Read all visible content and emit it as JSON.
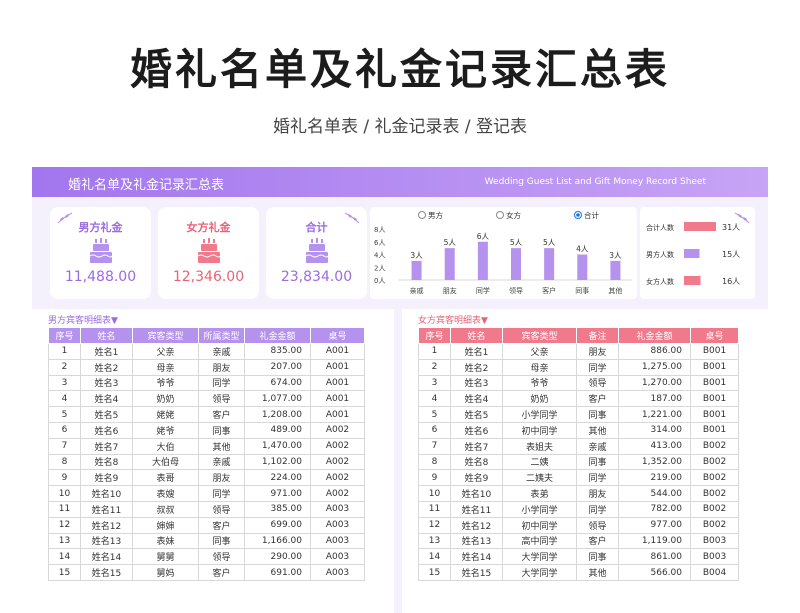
{
  "header": {
    "title": "婚礼名单及礼金记录汇总表",
    "subtitle": "婚礼名单表 / 礼金记录表 / 登记表"
  },
  "banner": {
    "title_cn": "婚礼名单及礼金记录汇总表",
    "title_en": "Wedding Guest List and Gift Money Record Sheet"
  },
  "colors": {
    "purple": "#b492ee",
    "pink": "#f07a8c",
    "purple_text": "#9b6be0",
    "pink_text": "#e8637a"
  },
  "cards": [
    {
      "label": "男方礼金",
      "value": "11,488.00",
      "icon": "cake-icon"
    },
    {
      "label": "女方礼金",
      "value": "12,346.00",
      "icon": "cake-icon"
    },
    {
      "label": "合计",
      "value": "23,834.00",
      "icon": "cake-icon"
    }
  ],
  "chart_data": {
    "type": "bar",
    "radio_options": [
      "男方",
      "女方",
      "合计"
    ],
    "selected": "合计",
    "categories": [
      "亲戚",
      "朋友",
      "同学",
      "领导",
      "客户",
      "同事",
      "其他"
    ],
    "values": [
      3,
      5,
      6,
      5,
      5,
      4,
      3
    ],
    "data_labels": [
      "3人",
      "5人",
      "6人",
      "5人",
      "5人",
      "4人",
      "3人"
    ],
    "yticks": [
      "0人",
      "2人",
      "4人",
      "6人",
      "8人"
    ],
    "ylim": [
      0,
      8
    ]
  },
  "legend_summary": [
    {
      "label": "合计人数",
      "value": "31人",
      "count": 31,
      "color": "#f07a8c"
    },
    {
      "label": "男方人数",
      "value": "15人",
      "count": 15,
      "color": "#b492ee"
    },
    {
      "label": "女方人数",
      "value": "16人",
      "count": 16,
      "color": "#f07a8c"
    }
  ],
  "male_table": {
    "title": "男方宾客明细表▼",
    "headers": [
      "序号",
      "姓名",
      "宾客类型",
      "所属类型",
      "礼金金额",
      "桌号"
    ],
    "rows": [
      [
        "1",
        "姓名1",
        "父亲",
        "亲戚",
        "835.00",
        "A001"
      ],
      [
        "2",
        "姓名2",
        "母亲",
        "朋友",
        "207.00",
        "A001"
      ],
      [
        "3",
        "姓名3",
        "爷爷",
        "同学",
        "674.00",
        "A001"
      ],
      [
        "4",
        "姓名4",
        "奶奶",
        "领导",
        "1,077.00",
        "A001"
      ],
      [
        "5",
        "姓名5",
        "姥姥",
        "客户",
        "1,208.00",
        "A001"
      ],
      [
        "6",
        "姓名6",
        "姥爷",
        "同事",
        "489.00",
        "A002"
      ],
      [
        "7",
        "姓名7",
        "大伯",
        "其他",
        "1,470.00",
        "A002"
      ],
      [
        "8",
        "姓名8",
        "大伯母",
        "亲戚",
        "1,102.00",
        "A002"
      ],
      [
        "9",
        "姓名9",
        "表哥",
        "朋友",
        "224.00",
        "A002"
      ],
      [
        "10",
        "姓名10",
        "表嫂",
        "同学",
        "971.00",
        "A002"
      ],
      [
        "11",
        "姓名11",
        "叔叔",
        "领导",
        "385.00",
        "A003"
      ],
      [
        "12",
        "姓名12",
        "婶婶",
        "客户",
        "699.00",
        "A003"
      ],
      [
        "13",
        "姓名13",
        "表妹",
        "同事",
        "1,166.00",
        "A003"
      ],
      [
        "14",
        "姓名14",
        "舅舅",
        "领导",
        "290.00",
        "A003"
      ],
      [
        "15",
        "姓名15",
        "舅妈",
        "客户",
        "691.00",
        "A003"
      ]
    ]
  },
  "female_table": {
    "title": "女方宾客明细表▼",
    "headers": [
      "序号",
      "姓名",
      "宾客类型",
      "备注",
      "礼金金额",
      "桌号"
    ],
    "rows": [
      [
        "1",
        "姓名1",
        "父亲",
        "朋友",
        "886.00",
        "B001"
      ],
      [
        "2",
        "姓名2",
        "母亲",
        "同学",
        "1,275.00",
        "B001"
      ],
      [
        "3",
        "姓名3",
        "爷爷",
        "领导",
        "1,270.00",
        "B001"
      ],
      [
        "4",
        "姓名4",
        "奶奶",
        "客户",
        "187.00",
        "B001"
      ],
      [
        "5",
        "姓名5",
        "小学同学",
        "同事",
        "1,221.00",
        "B001"
      ],
      [
        "6",
        "姓名6",
        "初中同学",
        "其他",
        "314.00",
        "B001"
      ],
      [
        "7",
        "姓名7",
        "表姐夫",
        "亲戚",
        "413.00",
        "B002"
      ],
      [
        "8",
        "姓名8",
        "二姨",
        "同事",
        "1,352.00",
        "B002"
      ],
      [
        "9",
        "姓名9",
        "二姨夫",
        "同学",
        "219.00",
        "B002"
      ],
      [
        "10",
        "姓名10",
        "表弟",
        "朋友",
        "544.00",
        "B002"
      ],
      [
        "11",
        "姓名11",
        "小学同学",
        "同学",
        "782.00",
        "B002"
      ],
      [
        "12",
        "姓名12",
        "初中同学",
        "领导",
        "977.00",
        "B002"
      ],
      [
        "13",
        "姓名13",
        "高中同学",
        "客户",
        "1,119.00",
        "B003"
      ],
      [
        "14",
        "姓名14",
        "大学同学",
        "同事",
        "861.00",
        "B003"
      ],
      [
        "15",
        "姓名15",
        "大学同学",
        "其他",
        "566.00",
        "B004"
      ]
    ]
  }
}
